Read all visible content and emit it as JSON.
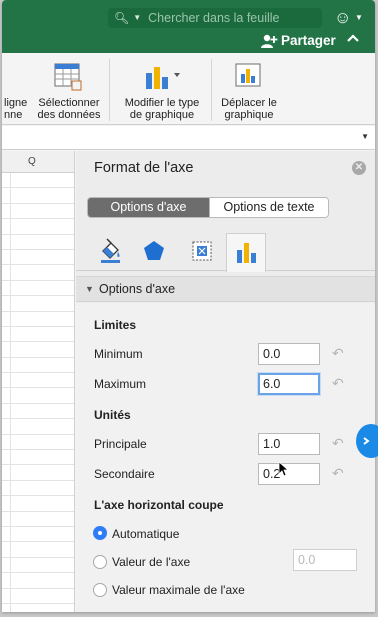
{
  "titlebar": {
    "search_placeholder": "Chercher dans la feuille",
    "share_label": "Partager",
    "collapse_glyph": "^",
    "icons": [
      "search-icon",
      "smiley-icon",
      "share-person-icon",
      "chevron-up-icon"
    ]
  },
  "ribbon": {
    "partial_label_line1": "ligne",
    "partial_label_line2": "nne",
    "select_data_line1": "Sélectionner",
    "select_data_line2": "des données",
    "change_type_line1": "Modifier le type",
    "change_type_line2": "de graphique",
    "move_chart_line1": "Déplacer le",
    "move_chart_line2": "graphique"
  },
  "sheet": {
    "column_header": "Q"
  },
  "panel": {
    "title": "Format de l'axe",
    "segment_active": "Options d'axe",
    "segment_inactive": "Options de texte",
    "tabs": [
      "fill-line-icon",
      "effects-pentagon-icon",
      "size-properties-icon",
      "axis-options-bar-icon"
    ],
    "section_title": "Options d'axe",
    "limits_heading": "Limites",
    "minimum_label": "Minimum",
    "minimum_value": "0.0",
    "maximum_label": "Maximum",
    "maximum_value": "6.0",
    "units_heading": "Unités",
    "major_label": "Principale",
    "major_value": "1.0",
    "minor_label": "Secondaire",
    "minor_value": "0.2",
    "crosses_heading": "L'axe horizontal coupe",
    "radio_auto": "Automatique",
    "radio_value": "Valeur de l'axe",
    "radio_value_field": "0.0",
    "radio_max": "Valeur maximale de l'axe"
  },
  "colors": {
    "titlebar_green": "#227447",
    "accent_blue": "#2e7cf6",
    "focus_ring": "#6aa3e8"
  }
}
